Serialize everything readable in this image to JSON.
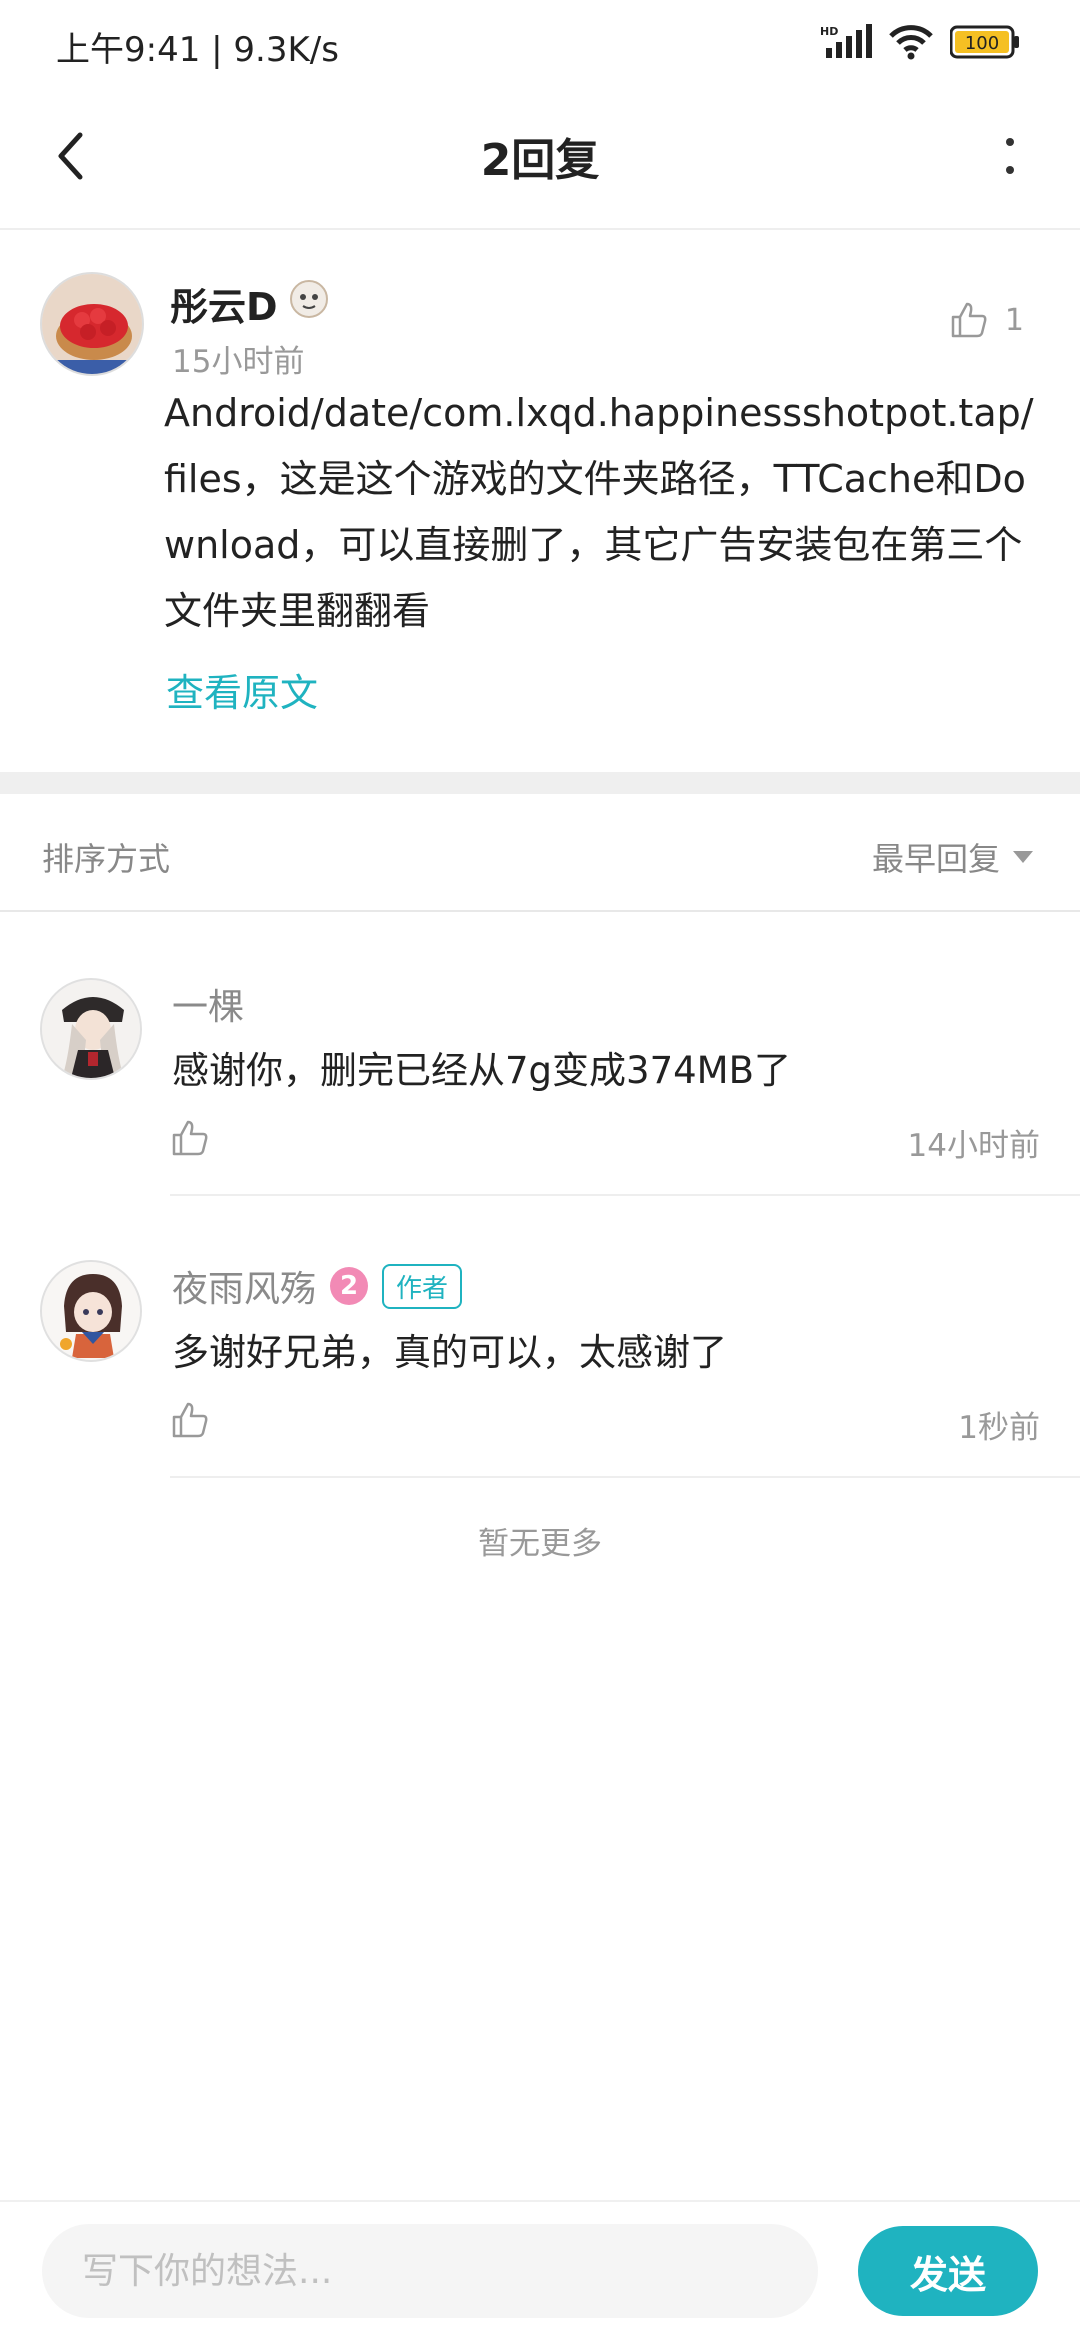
{
  "status_bar": {
    "time": "上午9:41 | 9.3K/s",
    "network": "HD",
    "battery": "100"
  },
  "header": {
    "title": "2回复",
    "back_icon": "chevron-left-icon",
    "more_icon": "more-vertical-icon"
  },
  "main_comment": {
    "author": "彤云D",
    "time": "15小时前",
    "likes": "1",
    "text": "Android/date/com.lxqd.happinessshotpot.tap/files，这是这个游戏的文件夹路径，TTCache和Download，可以直接删了，其它广告安装包在第三个文件夹里翻翻看",
    "view_original": "查看原文"
  },
  "sort": {
    "label": "排序方式",
    "selected": "最早回复"
  },
  "replies": [
    {
      "author": "一棵",
      "text": "感谢你，删完已经从7g变成374MB了",
      "time": "14小时前"
    },
    {
      "author": "夜雨风殇",
      "level": "2",
      "tag": "作者",
      "text": "多谢好兄弟，真的可以，太感谢了",
      "time": "1秒前"
    }
  ],
  "no_more": "暂无更多",
  "bottom_bar": {
    "placeholder": "写下你的想法...",
    "send_label": "发送"
  },
  "colors": {
    "accent": "#1fb3c0",
    "level_badge": "#f28ab5",
    "battery": "#f5c023"
  }
}
